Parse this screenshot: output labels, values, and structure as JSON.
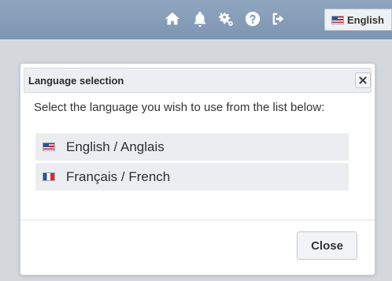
{
  "topbar": {
    "icons": [
      "home-icon",
      "bell-icon",
      "cogs-icon",
      "help-icon",
      "sign-out-icon"
    ],
    "language_button": {
      "label": "English",
      "flag": "us-flag-icon"
    }
  },
  "dialog": {
    "title": "Language selection",
    "close_icon": "close-icon",
    "instruction": "Select the language you wish to use from the list below:",
    "languages": [
      {
        "label": "English / Anglais",
        "flag": "us-flag-icon"
      },
      {
        "label": "Français / French",
        "flag": "fr-flag-icon"
      }
    ],
    "close_button_label": "Close"
  },
  "colors": {
    "topbar": "#8fa6c0",
    "dialog_header": "#eceef1",
    "list_item": "#ebedf0"
  }
}
